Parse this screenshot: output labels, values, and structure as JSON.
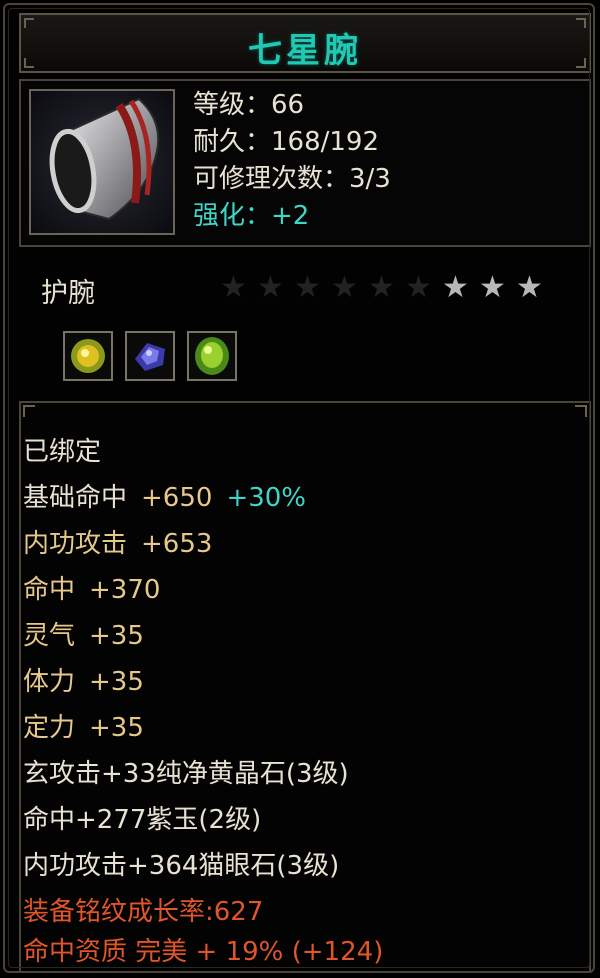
{
  "item": {
    "name": "七星腕",
    "stats": [
      "等级：66",
      "耐久：168/192",
      "可修理次数：3/3"
    ],
    "enhance": "强化：+2",
    "type": "护腕",
    "stars": {
      "total": 9,
      "lit": 3
    },
    "gems": [
      "yellow-gem-icon",
      "purple-jade-icon",
      "cats-eye-gem-icon"
    ]
  },
  "properties": {
    "bound": "已绑定",
    "base_hit_label": "基础命中",
    "base_hit_value": "+650",
    "base_hit_bonus": "+30%",
    "rows": [
      {
        "label": "内功攻击",
        "value": "+653"
      },
      {
        "label": "命中",
        "value": "+370"
      },
      {
        "label": "灵气",
        "value": "+35"
      },
      {
        "label": "体力",
        "value": "+35"
      },
      {
        "label": "定力",
        "value": "+35"
      }
    ],
    "gem_lines": [
      "玄攻击+33纯净黄晶石(3级)",
      "命中+277紫玉(2级)",
      "内功攻击+364猫眼石(3级)"
    ],
    "growth": "装备铭纹成长率:627",
    "quality": "命中资质 完美 + 19% (+124)"
  },
  "colors": {
    "title": "#1fc9b4",
    "enhance": "#3fd6c8",
    "gold": "#e6c88a",
    "red": "#e0552a"
  }
}
